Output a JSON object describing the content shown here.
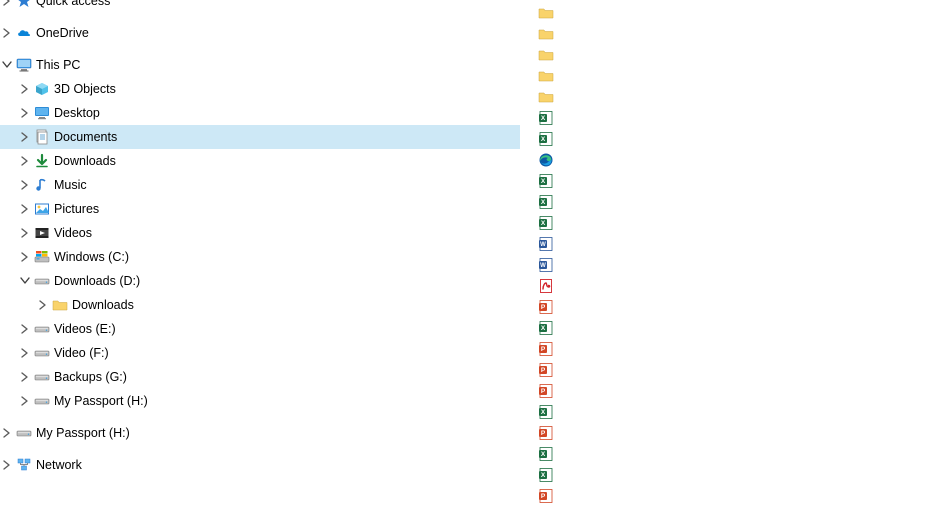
{
  "nav": {
    "quick_access": "Quick access",
    "onedrive": "OneDrive",
    "this_pc": "This PC",
    "children": {
      "objects3d": "3D Objects",
      "desktop": "Desktop",
      "documents": "Documents",
      "downloads": "Downloads",
      "music": "Music",
      "pictures": "Pictures",
      "videos": "Videos",
      "drive_c": "Windows (C:)",
      "drive_d": "Downloads (D:)",
      "drive_d_child": "Downloads",
      "drive_e": "Videos (E:)",
      "drive_f": "Video (F:)",
      "drive_g": "Backups (G:)",
      "drive_h": "My Passport (H:)"
    },
    "drive_h_root": "My Passport (H:)",
    "network": "Network"
  },
  "files": [
    {
      "icon": "folder"
    },
    {
      "icon": "folder"
    },
    {
      "icon": "folder"
    },
    {
      "icon": "folder"
    },
    {
      "icon": "folder"
    },
    {
      "icon": "excel"
    },
    {
      "icon": "excel"
    },
    {
      "icon": "edge"
    },
    {
      "icon": "excel"
    },
    {
      "icon": "excel"
    },
    {
      "icon": "excel"
    },
    {
      "icon": "word"
    },
    {
      "icon": "word"
    },
    {
      "icon": "pdf"
    },
    {
      "icon": "powerpoint"
    },
    {
      "icon": "excel"
    },
    {
      "icon": "powerpoint"
    },
    {
      "icon": "powerpoint"
    },
    {
      "icon": "powerpoint"
    },
    {
      "icon": "excel"
    },
    {
      "icon": "powerpoint"
    },
    {
      "icon": "excel"
    },
    {
      "icon": "excel"
    },
    {
      "icon": "powerpoint"
    }
  ]
}
